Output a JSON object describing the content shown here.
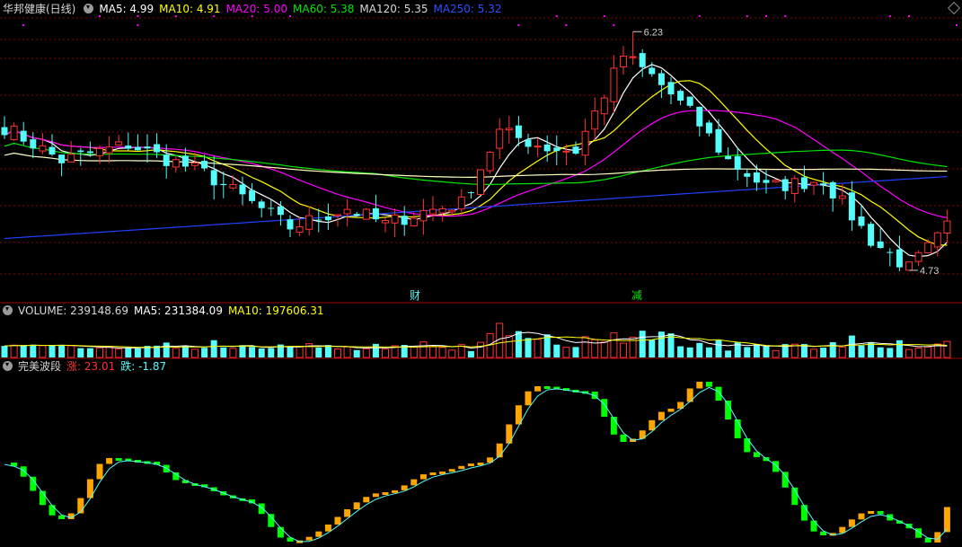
{
  "header": {
    "title": "华邦健康(日线)",
    "ma5": "MA5: 4.99",
    "ma10": "MA10: 4.91",
    "ma20": "MA20: 5.00",
    "ma60": "MA60: 5.38",
    "ma120": "MA120: 5.35",
    "ma250": "MA250: 5.32"
  },
  "volume_header": {
    "volume": "VOLUME: 239148.69",
    "ma5": "MA5: 231384.09",
    "ma10": "MA10: 197606.31"
  },
  "indicator_header": {
    "name": "完美波段",
    "up": "涨: 23.01",
    "down": "跌: -1.87"
  },
  "annotations": {
    "high": "6.23",
    "low": "4.73",
    "marker_cai": "财",
    "marker_jian": "减"
  },
  "colors": {
    "up": "#ff3232",
    "down": "#54fcfc",
    "ma5": "#ffffff",
    "ma10": "#ffff00",
    "ma20": "#ff00ff",
    "ma60": "#00e600",
    "ma120": "#ffffc0",
    "ma250": "#2040ff",
    "wave_up": "#ffa500",
    "wave_down": "#00ff00",
    "grid": "#8b0000",
    "separator": "#a00000"
  },
  "chart_data": {
    "type": "candlestick",
    "price_range": [
      4.6,
      6.35
    ],
    "candles": 100,
    "close_key_points": [
      {
        "i": 0,
        "c": 5.63
      },
      {
        "i": 6,
        "c": 5.42
      },
      {
        "i": 13,
        "c": 5.52
      },
      {
        "i": 21,
        "c": 5.34
      },
      {
        "i": 30,
        "c": 5.0
      },
      {
        "i": 36,
        "c": 5.12
      },
      {
        "i": 40,
        "c": 5.02
      },
      {
        "i": 44,
        "c": 5.1
      },
      {
        "i": 48,
        "c": 5.15
      },
      {
        "i": 52,
        "c": 5.6
      },
      {
        "i": 57,
        "c": 5.5
      },
      {
        "i": 60,
        "c": 5.48
      },
      {
        "i": 65,
        "c": 6.08
      },
      {
        "i": 68,
        "c": 5.95
      },
      {
        "i": 72,
        "c": 5.72
      },
      {
        "i": 76,
        "c": 5.42
      },
      {
        "i": 80,
        "c": 5.25
      },
      {
        "i": 86,
        "c": 5.3
      },
      {
        "i": 91,
        "c": 4.92
      },
      {
        "i": 95,
        "c": 4.74
      },
      {
        "i": 99,
        "c": 4.99
      }
    ],
    "high": 6.23,
    "low": 4.73,
    "ma_last": {
      "MA5": 4.99,
      "MA10": 4.91,
      "MA20": 5.0,
      "MA60": 5.38,
      "MA120": 5.35,
      "MA250": 5.32
    },
    "volume_last": 239148.69,
    "indicator_last": {
      "up": 23.01,
      "down": -1.87
    }
  }
}
